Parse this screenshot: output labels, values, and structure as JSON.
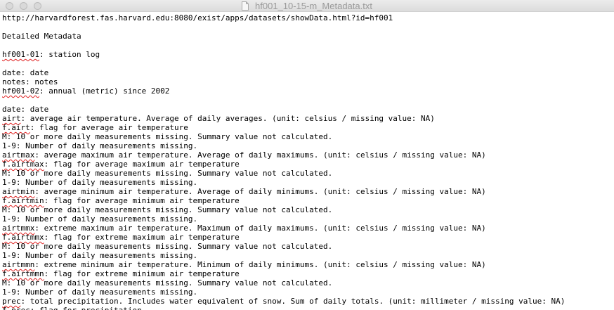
{
  "window": {
    "title": "hf001_10-15-m_Metadata.txt",
    "doc_icon": "text-document-icon"
  },
  "document": {
    "lines": [
      {
        "text": "http://harvardforest.fas.harvard.edu:8080/exist/apps/datasets/showData.html?id=hf001"
      },
      {
        "text": ""
      },
      {
        "text": "Detailed Metadata"
      },
      {
        "text": ""
      },
      {
        "flagged": "hf001-01",
        "text": ": station log"
      },
      {
        "text": ""
      },
      {
        "text": "date: date"
      },
      {
        "text": "notes: notes"
      },
      {
        "flagged": "hf001-02",
        "text": ": annual (metric) since 2002"
      },
      {
        "text": ""
      },
      {
        "text": "date: date"
      },
      {
        "flagged": "airt",
        "text": ": average air temperature. Average of daily averages. (unit: celsius / missing value: NA)"
      },
      {
        "flagged": "f.airt",
        "text": ": flag for average air temperature"
      },
      {
        "text": "M: 10 or more daily measurements missing. Summary value not calculated."
      },
      {
        "text": "1-9: Number of daily measurements missing."
      },
      {
        "flagged": "airtmax",
        "text": ": average maximum air temperature. Average of daily maximums. (unit: celsius / missing value: NA)"
      },
      {
        "flagged": "f.airtmax",
        "text": ": flag for average maximum air temperature"
      },
      {
        "text": "M: 10 or more daily measurements missing. Summary value not calculated."
      },
      {
        "text": "1-9: Number of daily measurements missing."
      },
      {
        "flagged": "airtmin",
        "text": ": average minimum air temperature. Average of daily minimums. (unit: celsius / missing value: NA)"
      },
      {
        "flagged": "f.airtmin",
        "text": ": flag for average minimum air temperature"
      },
      {
        "text": "M: 10 or more daily measurements missing. Summary value not calculated."
      },
      {
        "text": "1-9: Number of daily measurements missing."
      },
      {
        "flagged": "airtmmx",
        "text": ": extreme maximum air temperature. Maximum of daily maximums. (unit: celsius / missing value: NA)"
      },
      {
        "flagged": "f.airtmmx",
        "text": ": flag for extreme maximum air temperature"
      },
      {
        "text": "M: 10 or more daily measurements missing. Summary value not calculated."
      },
      {
        "text": "1-9: Number of daily measurements missing."
      },
      {
        "flagged": "airtmmn",
        "text": ": extreme minimum air temperature. Minimum of daily minimums. (unit: celsius / missing value: NA)"
      },
      {
        "flagged": "f.airtmmn",
        "text": ": flag for extreme minimum air temperature"
      },
      {
        "text": "M: 10 or more daily measurements missing. Summary value not calculated."
      },
      {
        "text": "1-9: Number of daily measurements missing."
      },
      {
        "flagged": "prec",
        "text": ": total precipitation. Includes water equivalent of snow. Sum of daily totals. (unit: millimeter / missing value: NA)"
      },
      {
        "flagged": "f.prec",
        "text": ": flag for precipitation"
      }
    ]
  }
}
